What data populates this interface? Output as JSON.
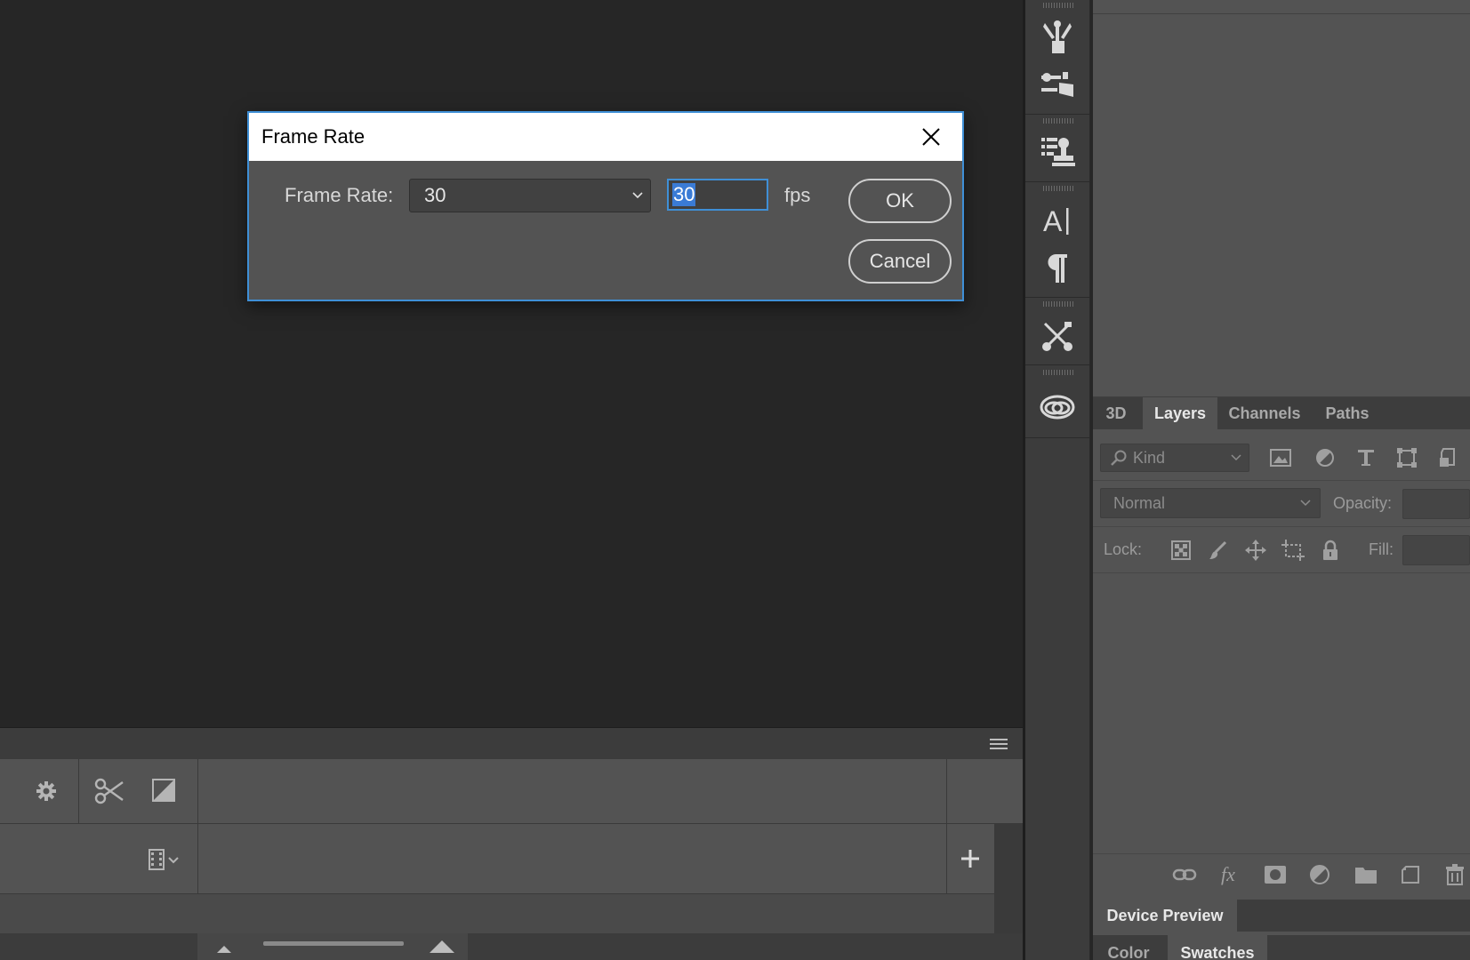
{
  "dialog": {
    "title": "Frame Rate",
    "frame_rate_label": "Frame Rate:",
    "frame_rate_select": "30",
    "frame_rate_input": "30",
    "unit": "fps",
    "ok_label": "OK",
    "cancel_label": "Cancel"
  },
  "layers_panel": {
    "tabs": [
      "3D",
      "Layers",
      "Channels",
      "Paths"
    ],
    "active_tab": "Layers",
    "filter_kind": "Kind",
    "blend_mode": "Normal",
    "opacity_label": "Opacity:",
    "lock_label": "Lock:",
    "fill_label": "Fill:"
  },
  "bottom_panels": {
    "device_preview_tab": "Device Preview",
    "color_tab": "Color",
    "swatches_tab": "Swatches"
  },
  "colors": {
    "accent": "#3f8fd6",
    "selection": "#3a7bd5"
  }
}
